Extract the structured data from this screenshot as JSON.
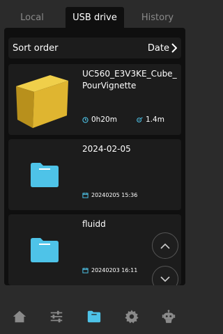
{
  "tabs": [
    {
      "label": "Local",
      "active": false
    },
    {
      "label": "USB drive",
      "active": true
    },
    {
      "label": "History",
      "active": false
    }
  ],
  "sort": {
    "label": "Sort order",
    "value": "Date"
  },
  "files": [
    {
      "type": "model",
      "name": "UC560_E3V3KE_Cube_PourVignette",
      "duration": "0h20m",
      "filament": "1.4m"
    },
    {
      "type": "folder",
      "name": "2024-02-05",
      "date": "20240205 15:36"
    },
    {
      "type": "folder",
      "name": "fluidd",
      "date": "20240203 16:11"
    }
  ],
  "nav": [
    "home-icon",
    "sliders-icon",
    "folder-icon",
    "gear-icon",
    "robot-icon"
  ],
  "colors": {
    "accent": "#4ec3e8",
    "cube": "#e0b830",
    "panel": "#0f0f0f",
    "card": "#1c1c1c",
    "bg": "#2b2b2b"
  }
}
